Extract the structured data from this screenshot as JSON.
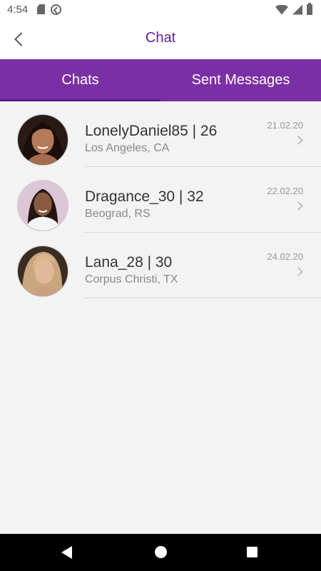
{
  "status_bar": {
    "time": "4:54",
    "icons_left": [
      "sd-card-icon",
      "sync-icon"
    ],
    "icons_right": [
      "wifi-icon",
      "signal-icon",
      "battery-icon"
    ]
  },
  "app_bar": {
    "title": "Chat",
    "back_icon": "chevron-left-icon"
  },
  "tabs": [
    {
      "label": "Chats",
      "active": true
    },
    {
      "label": "Sent Messages",
      "active": false
    }
  ],
  "chats": [
    {
      "name": "LonelyDaniel85 | 26",
      "location": "Los Angeles, CA",
      "date": "21.02.20"
    },
    {
      "name": "Dragance_30 | 32",
      "location": "Beograd, RS",
      "date": "22.02.20"
    },
    {
      "name": "Lana_28 | 30",
      "location": "Corpus Christi, TX",
      "date": "24.02.20"
    }
  ],
  "nav_bar": {
    "icons": [
      "nav-back-icon",
      "nav-home-icon",
      "nav-recents-icon"
    ]
  },
  "colors": {
    "accent": "#7b2fa5",
    "title": "#5e1f9e",
    "background": "#f3f3f3"
  }
}
